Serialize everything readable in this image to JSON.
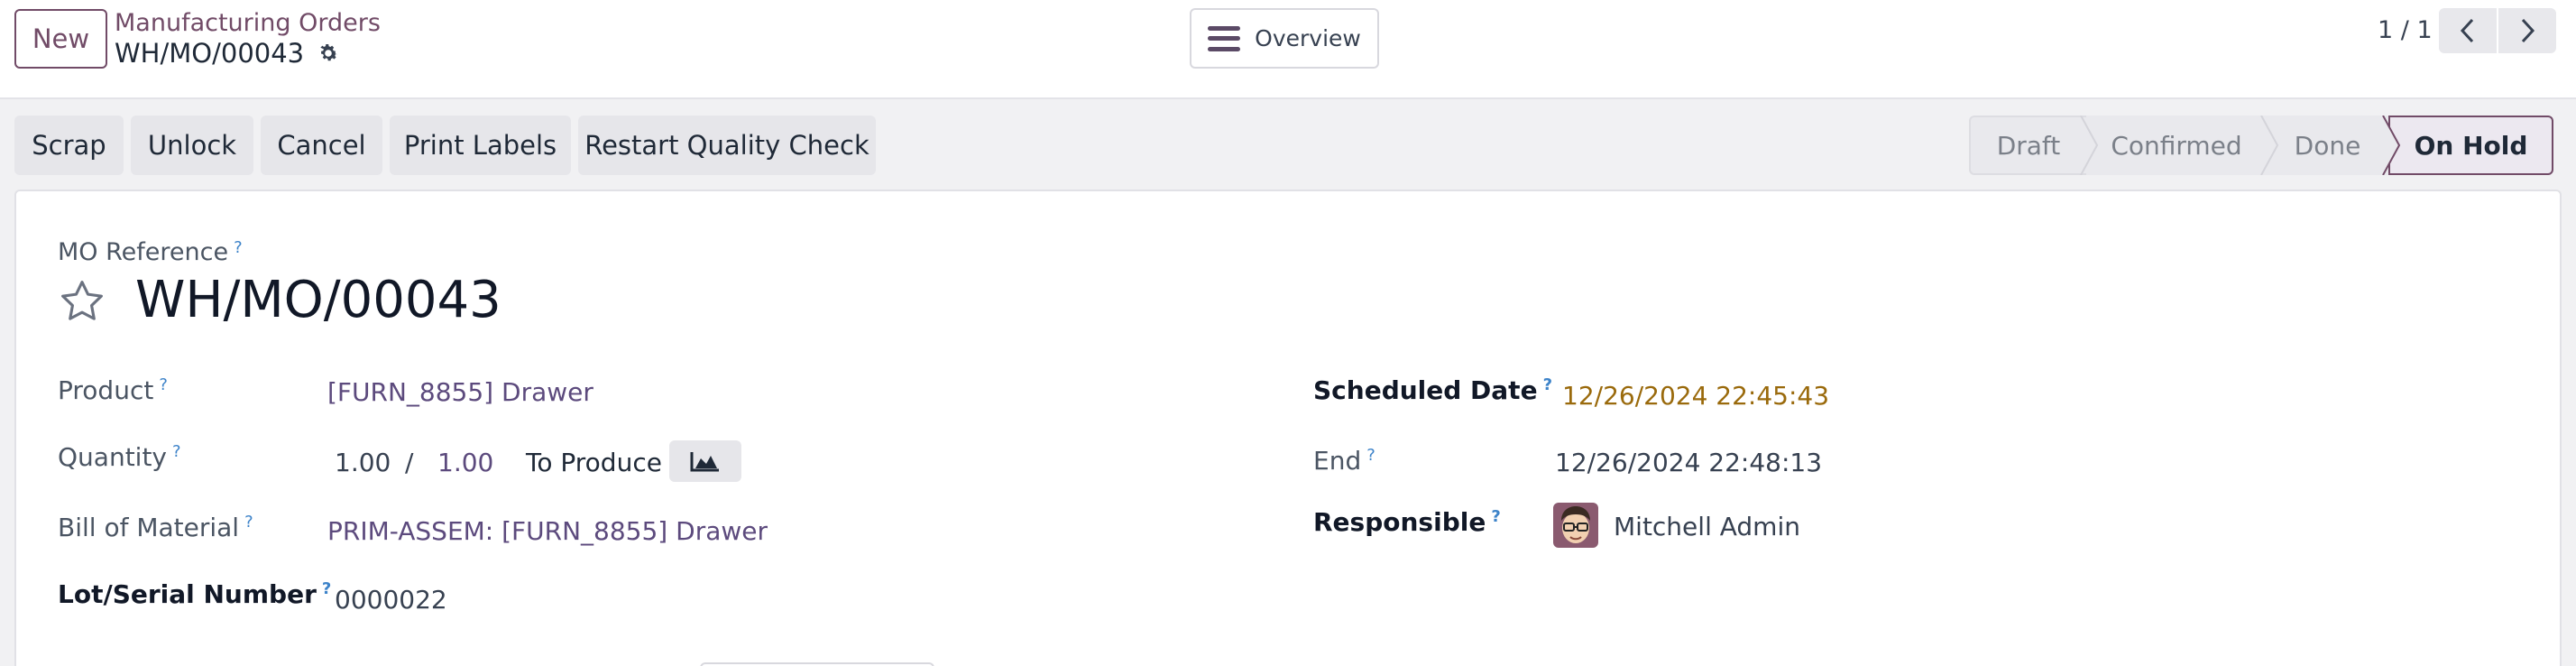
{
  "topbar": {
    "new_label": "New",
    "breadcrumb_parent": "Manufacturing Orders",
    "breadcrumb_current": "WH/MO/00043",
    "overview_label": "Overview",
    "pager_value": "1 / 1"
  },
  "actions": {
    "scrap": "Scrap",
    "unlock": "Unlock",
    "cancel": "Cancel",
    "print_labels": "Print Labels",
    "restart_quality_check": "Restart Quality Check"
  },
  "statusbar": {
    "stages": [
      "Draft",
      "Confirmed",
      "Done",
      "On Hold"
    ],
    "active": "On Hold"
  },
  "form": {
    "reference_label": "MO Reference",
    "reference_value": "WH/MO/00043",
    "help_mark": "?",
    "product_label": "Product",
    "product_value": "[FURN_8855] Drawer",
    "quantity_label": "Quantity",
    "quantity_produced": "1.00",
    "quantity_separator": "/",
    "quantity_total": "1.00",
    "quantity_suffix": "To Produce",
    "bom_label": "Bill of Material",
    "bom_value": "PRIM-ASSEM: [FURN_8855] Drawer",
    "lot_label": "Lot/Serial Number",
    "lot_value": "0000022",
    "scheduled_label": "Scheduled Date",
    "scheduled_value": "12/26/2024 22:45:43",
    "end_label": "End",
    "end_value": "12/26/2024 22:48:13",
    "responsible_label": "Responsible",
    "responsible_value": "Mitchell Admin"
  },
  "colors": {
    "brand": "#714b67",
    "link": "#5c4a7d",
    "date_warning": "#9a6a0c",
    "help": "#3d83c9"
  }
}
